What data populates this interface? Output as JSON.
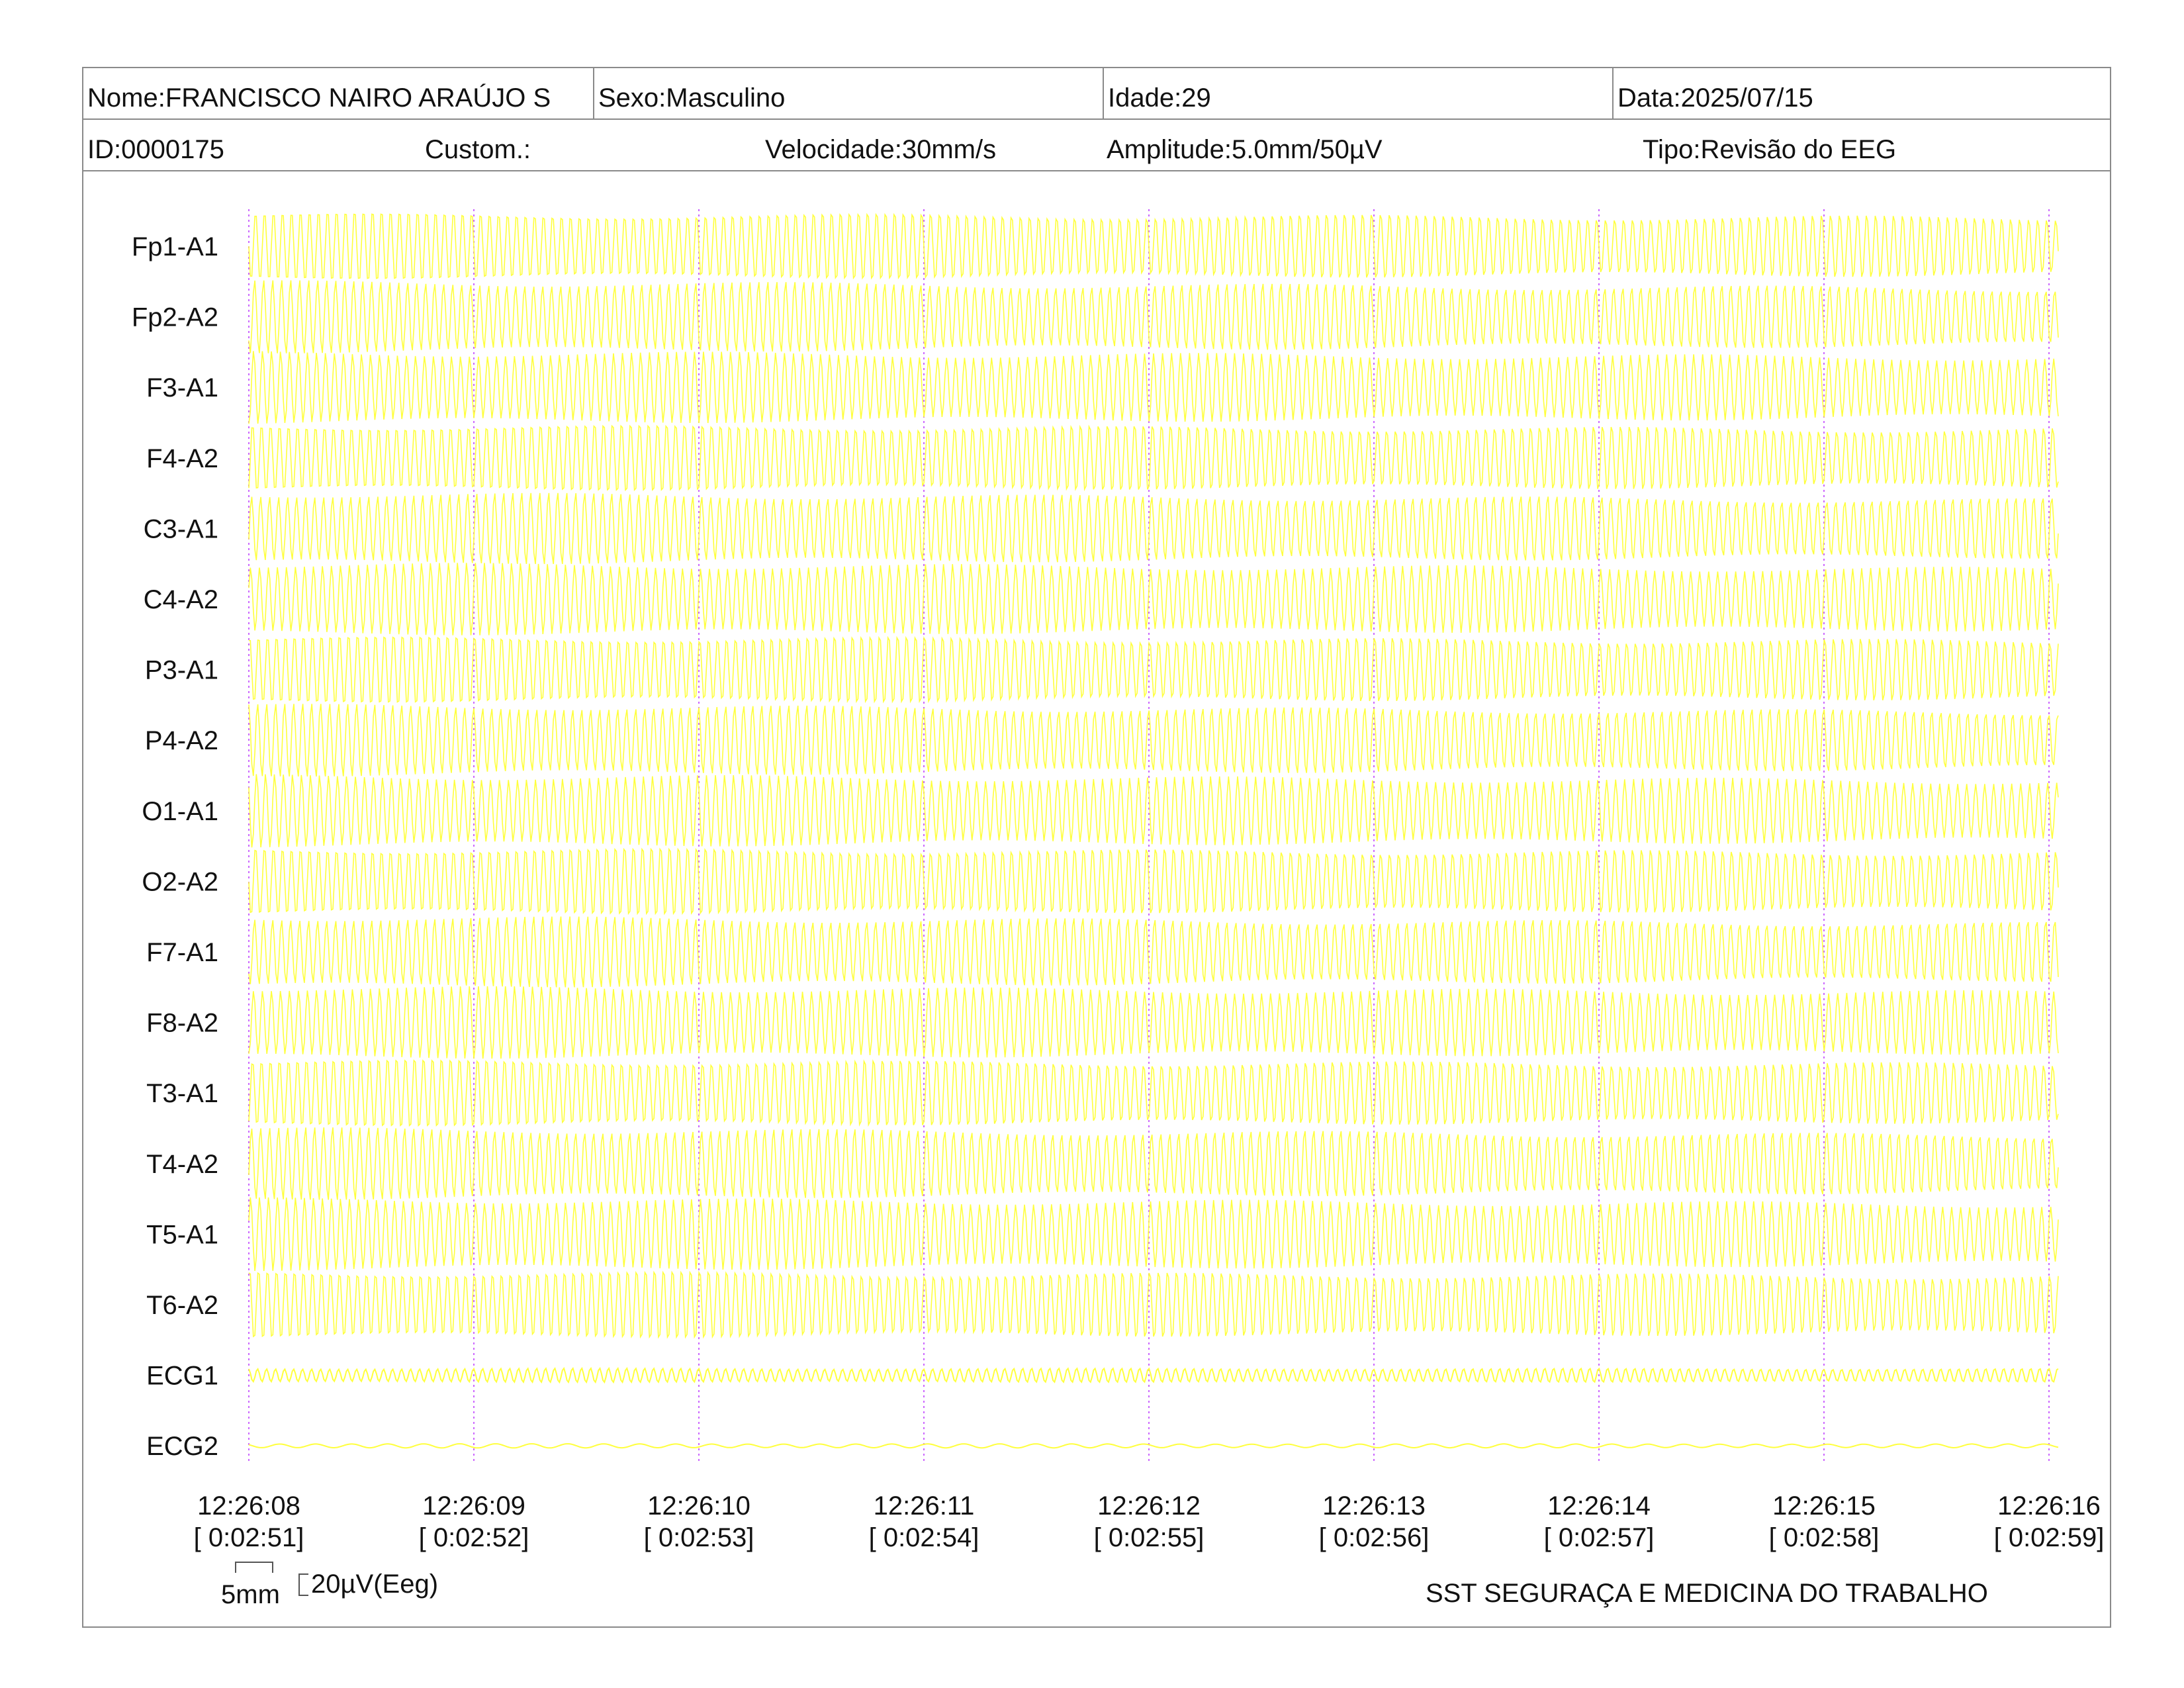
{
  "header": {
    "nome": "Nome:FRANCISCO NAIRO ARAÚJO S",
    "sexo": "Sexo:Masculino",
    "idade": "Idade:29",
    "data": "Data:2025/07/15",
    "id": "ID:0000175",
    "custom": "Custom.:",
    "velocidade": "Velocidade:30mm/s",
    "amplitude": "Amplitude:5.0mm/50µV",
    "tipo": "Tipo:Revisão do EEG"
  },
  "chart_data": {
    "type": "line",
    "title": "",
    "xlabel": "",
    "ylabel": "",
    "grid": "vertical dotted markers at each second",
    "trace_color": "#ffff33",
    "marker_color": "#cc66ff",
    "channels": [
      "Fp1-A1",
      "Fp2-A2",
      "F3-A1",
      "F4-A2",
      "C3-A1",
      "C4-A2",
      "P3-A1",
      "P4-A2",
      "O1-A1",
      "O2-A2",
      "F7-A1",
      "F8-A2",
      "T3-A1",
      "T4-A2",
      "T5-A1",
      "T6-A2",
      "ECG1",
      "ECG2"
    ],
    "time_ticks": [
      {
        "clock": "12:26:08",
        "elapsed": "[ 0:02:51]"
      },
      {
        "clock": "12:26:09",
        "elapsed": "[ 0:02:52]"
      },
      {
        "clock": "12:26:10",
        "elapsed": "[ 0:02:53]"
      },
      {
        "clock": "12:26:11",
        "elapsed": "[ 0:02:54]"
      },
      {
        "clock": "12:26:12",
        "elapsed": "[ 0:02:55]"
      },
      {
        "clock": "12:26:13",
        "elapsed": "[ 0:02:56]"
      },
      {
        "clock": "12:26:14",
        "elapsed": "[ 0:02:57]"
      },
      {
        "clock": "12:26:15",
        "elapsed": "[ 0:02:58]"
      },
      {
        "clock": "12:26:16",
        "elapsed": "[ 0:02:59]"
      }
    ],
    "eeg_cycles_per_second": 25,
    "scale_bar": {
      "time_label": "5mm",
      "amp_label": "20µV(Eeg)"
    }
  },
  "footer": {
    "company": "SST SEGURAÇA E MEDICINA DO TRABALHO"
  }
}
